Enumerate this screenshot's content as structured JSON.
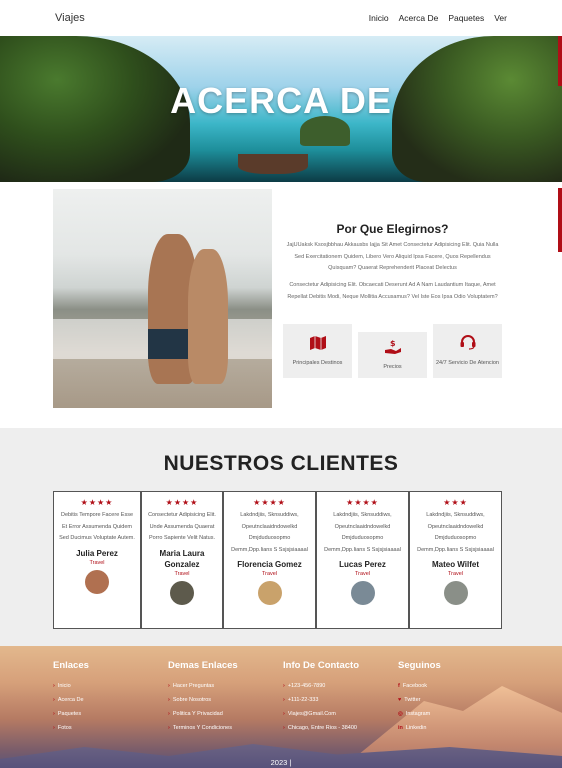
{
  "nav": {
    "brand": "Viajes",
    "links": [
      "Inicio",
      "Acerca De",
      "Paquetes",
      "Ver"
    ]
  },
  "hero": {
    "title": "ACERCA DE"
  },
  "about": {
    "title": "Por Que Elegirnos?",
    "p1": "JajUUaksk Ksosjbbhau Akkausbs Iajja Sit Amet Consectetur Adipisicing Elit. Quia Nulla Sed Exercitationem Quidem, Libero Vero Aliquid Ipsa Facere, Quos Repellendus Quisquam? Quaerat Reprehenderit Placeat Delectus",
    "p2": "Consectetur Adipisicing Elit. Obcaecati Deserunt Ad A Nam Laudantium Itaque, Amet Repellat Debitis Modi, Neque Mollitia Accusamus? Vel Iste Eos Ipsa Odio Voluptatem?",
    "features": [
      {
        "icon": "map-icon",
        "label": "Principales Destinos"
      },
      {
        "icon": "dollar-hand-icon",
        "label": "Precios"
      },
      {
        "icon": "headset-icon",
        "label": "24/7 Servicio De Atencion"
      }
    ]
  },
  "clients": {
    "title": "NUESTROS CLIENTES",
    "cards": [
      {
        "stars": "★★★★",
        "text": "Debitis Tempore Facere Esse Et Error Assumenda Quidem Sed Ducimus Voluptate Autem.",
        "name": "Julia Perez",
        "role": "Travel",
        "avatar": "#b07050"
      },
      {
        "stars": "★★★★",
        "text": "Consectetur Adipisicing Elit. Unde Assumenda Quaerat Porro Sapiente Velit Natus.",
        "name": "Maria Laura Gonzalez",
        "role": "Travel",
        "avatar": "#5d5a4c"
      },
      {
        "stars": "★★★★",
        "text": "Lakdndjiis, Sknsuddiws, Opeutnclaaidndowelkd Dmjduduosopmo Demm,Dpp.Iians S Ssjsjsiaaaal",
        "name": "Florencia Gomez",
        "role": "Travel",
        "avatar": "#c9a26b"
      },
      {
        "stars": "★★★★",
        "text": "Lakdndjiis, Sknsuddiws, Opeutnclaaidndowelkd Dmjduduosopmo Demm,Dpp.Iians S Ssjsjsiaaaal",
        "name": "Lucas Perez",
        "role": "Travel",
        "avatar": "#7a8a96"
      },
      {
        "stars": "★★★",
        "text": "Lakdndjiis, Sknsuddiws, Opeutnclaaidndowelkd Dmjduduosopmo Demm,Dpp.Iians S Ssjsjsiaaaal",
        "name": "Mateo Wilfet",
        "role": "Travel",
        "avatar": "#8a8f88"
      }
    ]
  },
  "footer": {
    "col1": {
      "title": "Enlaces",
      "items": [
        "Inicio",
        "Acerca De",
        "Paquetes",
        "Fotos"
      ]
    },
    "col2": {
      "title": "Demas Enlaces",
      "items": [
        "Hacer Preguntas",
        "Sobre Nosotros",
        "Politica Y Privacidad",
        "Terminos Y Condiciones"
      ]
    },
    "col3": {
      "title": "Info De Contacto",
      "items": [
        "+123-456-7890",
        "+111-22-333",
        "Viajes@Gmail.Com",
        "Chicago, Entre Rios - 38400"
      ]
    },
    "col4": {
      "title": "Seguinos",
      "items": [
        "Facebook",
        "Twitter",
        "Instagram",
        "Linkedin"
      ]
    },
    "copyright": "2023 |"
  },
  "colors": {
    "accent": "#b00e17",
    "light_bg": "#eeeeee"
  }
}
